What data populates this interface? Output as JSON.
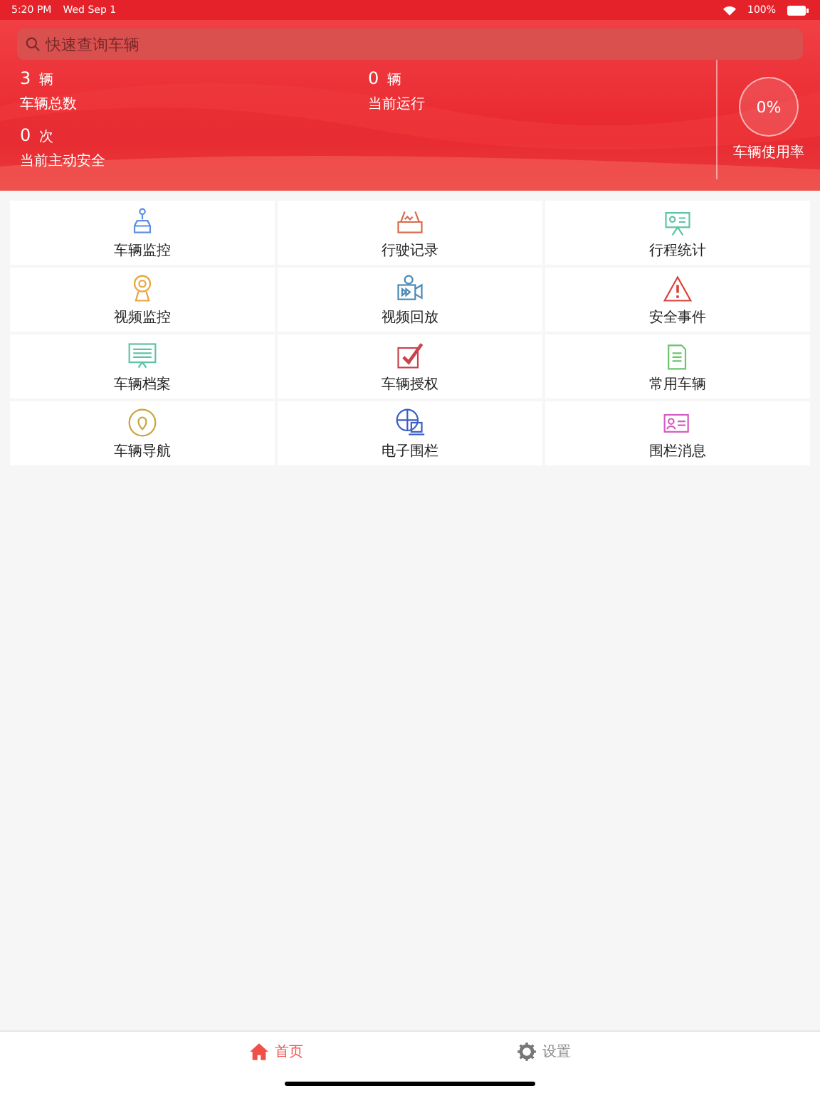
{
  "status_bar": {
    "time": "5:20 PM",
    "date": "Wed Sep 1",
    "battery": "100%"
  },
  "search": {
    "placeholder": "快速查询车辆"
  },
  "stats": [
    {
      "value": "3",
      "unit": "辆",
      "label": "车辆总数"
    },
    {
      "value": "0",
      "unit": "辆",
      "label": "当前运行"
    },
    {
      "value": "0",
      "unit": "次",
      "label": "当前主动安全"
    }
  ],
  "usage": {
    "reading": "0%",
    "label": "车辆使用率"
  },
  "menu": [
    {
      "label": "车辆监控"
    },
    {
      "label": "行驶记录"
    },
    {
      "label": "行程统计"
    },
    {
      "label": "视频监控"
    },
    {
      "label": "视频回放"
    },
    {
      "label": "安全事件"
    },
    {
      "label": "车辆档案"
    },
    {
      "label": "车辆授权"
    },
    {
      "label": "常用车辆"
    },
    {
      "label": "车辆导航"
    },
    {
      "label": "电子围栏"
    },
    {
      "label": "围栏消息"
    }
  ],
  "tabs": [
    {
      "label": "首页",
      "selected": true
    },
    {
      "label": "设置",
      "selected": false
    }
  ]
}
